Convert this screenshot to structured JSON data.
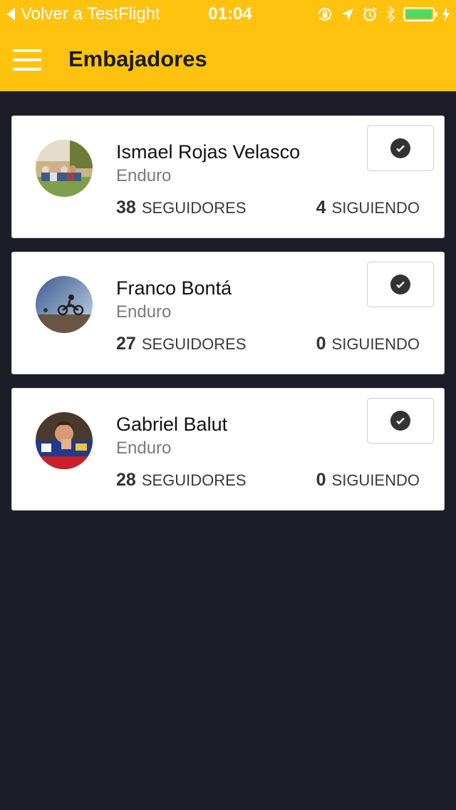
{
  "status_bar": {
    "back_label": "Volver a TestFlight",
    "time": "01:04",
    "battery_color": "#4cd964"
  },
  "header": {
    "title": "Embajadores"
  },
  "colors": {
    "accent": "#ffc20e",
    "background": "#1d1d28"
  },
  "ambassadors": [
    {
      "name": "Ismael Rojas Velasco",
      "category": "Enduro",
      "followers_count": "38",
      "followers_label": "SEGUIDORES",
      "following_count": "4",
      "following_label": "SIGUIENDO",
      "following_state": true
    },
    {
      "name": "Franco Bontá",
      "category": "Enduro",
      "followers_count": "27",
      "followers_label": "SEGUIDORES",
      "following_count": "0",
      "following_label": "SIGUIENDO",
      "following_state": true
    },
    {
      "name": "Gabriel Balut",
      "category": "Enduro",
      "followers_count": "28",
      "followers_label": "SEGUIDORES",
      "following_count": "0",
      "following_label": "SIGUIENDO",
      "following_state": true
    }
  ]
}
